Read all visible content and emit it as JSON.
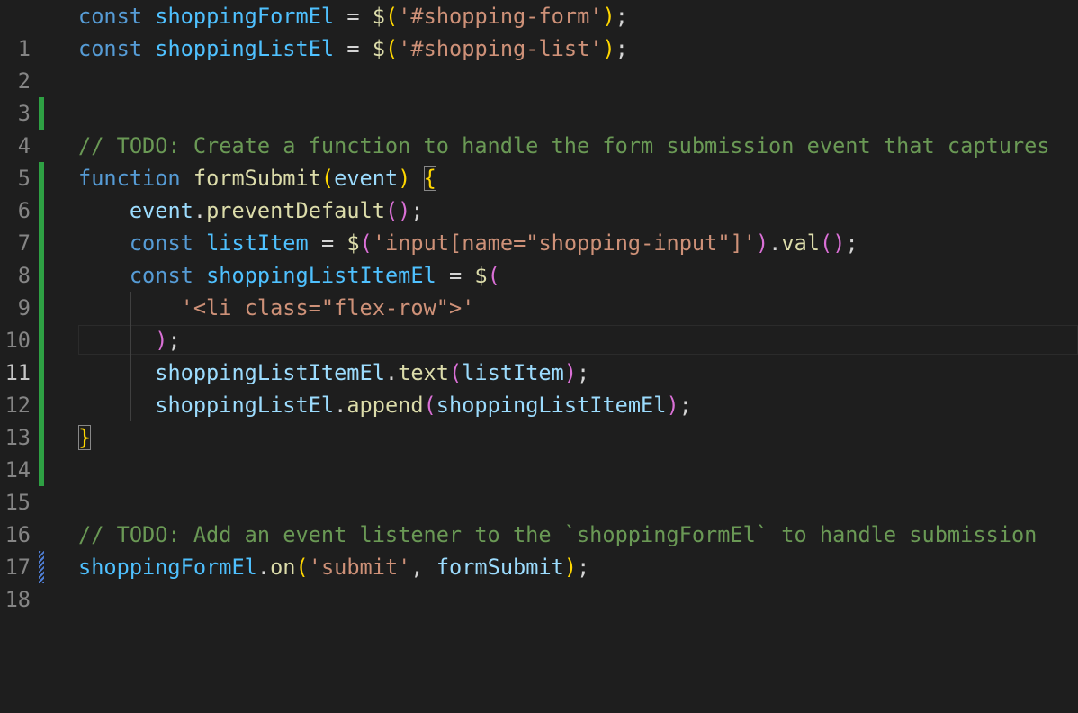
{
  "editor": {
    "active_line": 11,
    "line_numbers": [
      "1",
      "2",
      "3",
      "4",
      "5",
      "6",
      "7",
      "8",
      "9",
      "10",
      "11",
      "12",
      "13",
      "14",
      "15",
      "16",
      "17",
      "18"
    ],
    "lines": {
      "l1": {
        "kw": "const",
        "var": "shoppingFormEl",
        "eq": "=",
        "dollar": "$",
        "open": "(",
        "str": "'#shopping-form'",
        "close": ")",
        "semi": ";"
      },
      "l2": {
        "kw": "const",
        "var": "shoppingListEl",
        "eq": "=",
        "dollar": "$",
        "open": "(",
        "str": "'#shopping-list'",
        "close": ")",
        "semi": ";"
      },
      "l5": {
        "comment": "// TODO: Create a function to handle the form submission event that captures"
      },
      "l6": {
        "kw": "function",
        "fn": "formSubmit",
        "open": "(",
        "param": "event",
        "close": ")",
        "brace": "{"
      },
      "l7": {
        "var": "event",
        "dot": ".",
        "fn": "preventDefault",
        "open": "(",
        "close": ")",
        "semi": ";"
      },
      "l8": {
        "kw": "const",
        "var": "listItem",
        "eq": "=",
        "dollar": "$",
        "open": "(",
        "str": "'input[name=\"shopping-input\"]'",
        "close": ")",
        "dot": ".",
        "fn": "val",
        "open2": "(",
        "close2": ")",
        "semi": ";"
      },
      "l9": {
        "kw": "const",
        "var": "shoppingListItemEl",
        "eq": "=",
        "dollar": "$",
        "open": "("
      },
      "l10": {
        "str": "'<li class=\"flex-row\">'"
      },
      "l11": {
        "close": ")",
        "semi": ";"
      },
      "l12": {
        "var": "shoppingListItemEl",
        "dot": ".",
        "fn": "text",
        "open": "(",
        "arg": "listItem",
        "close": ")",
        "semi": ";"
      },
      "l13": {
        "var": "shoppingListEl",
        "dot": ".",
        "fn": "append",
        "open": "(",
        "arg": "shoppingListItemEl",
        "close": ")",
        "semi": ";"
      },
      "l14": {
        "brace": "}"
      },
      "l17": {
        "comment": "// TODO: Add an event listener to the `shoppingFormEl` to handle submission"
      },
      "l18": {
        "var": "shoppingFormEl",
        "dot": ".",
        "fn": "on",
        "open": "(",
        "str": "'submit'",
        "comma": ",",
        "arg": "formSubmit",
        "close": ")",
        "semi": ";"
      }
    },
    "change_indicators": {
      "added_lines": [
        "4",
        "6",
        "7",
        "8",
        "9",
        "10",
        "11",
        "12",
        "13",
        "14",
        "15"
      ],
      "modified_lines": [
        "18"
      ]
    },
    "colors": {
      "background": "#1e1e1e",
      "keyword": "#569cd6",
      "variable": "#9cdcfe",
      "constant": "#4fc1ff",
      "function": "#dcdcaa",
      "string": "#ce9178",
      "comment": "#6a9955",
      "bracket_level1": "#ffd700",
      "bracket_level2": "#da70d6",
      "bracket_level3": "#179fff",
      "added_bar": "#2ea043",
      "modified_bar": "#4f7fd6"
    }
  }
}
